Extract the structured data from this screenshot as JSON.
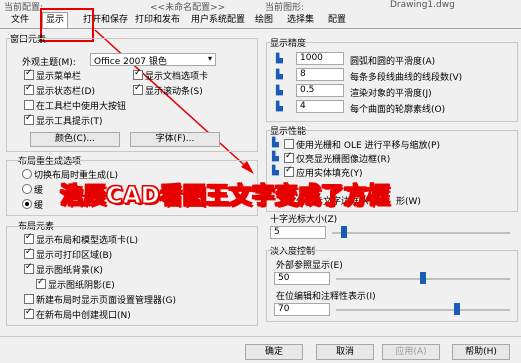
{
  "header": {
    "current_profile_label": "当前配置:",
    "current_profile_value": "<<未命名配置>>",
    "current_drawing_label": "当前图形:",
    "current_drawing_value": "Drawing1.dwg"
  },
  "tabs": [
    {
      "label": "文件"
    },
    {
      "label": "显示"
    },
    {
      "label": "打开和保存"
    },
    {
      "label": "打印和发布"
    },
    {
      "label": "用户系统配置"
    },
    {
      "label": "绘图"
    },
    {
      "label": "选择集"
    },
    {
      "label": "配置"
    }
  ],
  "window_elements": {
    "title": "窗口元素",
    "theme_label": "外观主题(M):",
    "theme_value": "Office 2007 银色",
    "checks": [
      {
        "label": "显示菜单栏",
        "checked": true
      },
      {
        "label": "显示文档选项卡",
        "checked": true
      },
      {
        "label": "显示状态栏(D)",
        "checked": true
      },
      {
        "label": "显示滚动条(S)",
        "checked": true
      },
      {
        "label": "在工具栏中使用大按钮",
        "checked": false
      },
      {
        "label": "显示工具提示(T)",
        "checked": true
      }
    ],
    "color_button": "颜色(C)...",
    "font_button": "字体(F)..."
  },
  "layout_regen": {
    "title": "布局重生成选项",
    "options": [
      {
        "label": "切换布局时重生成(L)"
      },
      {
        "label": "缓"
      },
      {
        "label": "缓"
      }
    ]
  },
  "layout_elements": {
    "title": "布局元素",
    "checks": [
      {
        "label": "显示布局和模型选项卡(L)",
        "checked": true
      },
      {
        "label": "显示可打印区域(B)",
        "checked": true
      },
      {
        "label": "显示图纸背景(K)",
        "checked": true
      },
      {
        "label": "显示图纸阴影(E)",
        "checked": true
      },
      {
        "label": "新建布局时显示页面设置管理器(G)",
        "checked": false
      },
      {
        "label": "在新布局中创建视口(N)",
        "checked": true
      }
    ]
  },
  "display_precision": {
    "title": "显示精度",
    "rows": [
      {
        "value": "1000",
        "label": "圆弧和圆的平滑度(A)"
      },
      {
        "value": "8",
        "label": "每条多段线曲线的线段数(V)"
      },
      {
        "value": "0.5",
        "label": "渲染对象的平滑度(J)"
      },
      {
        "value": "4",
        "label": "每个曲面的轮廓素线(O)"
      }
    ]
  },
  "display_performance": {
    "title": "显示性能",
    "checks": [
      {
        "label": "使用光栅和 OLE 进行平移与缩放(P)",
        "checked": false
      },
      {
        "label": "仅亮显光栅图像边框(R)",
        "checked": true
      },
      {
        "label": "应用实体填充(Y)",
        "checked": true
      },
      {
        "label": "仅显示文字边框(X)",
        "checked": false
      }
    ],
    "extra_button": "形(W)"
  },
  "crosshair": {
    "title": "十字光标大小(Z)",
    "value": "5",
    "level": 0.05
  },
  "fade": {
    "title": "淡入度控制",
    "xref_label": "外部参照显示(E)",
    "xref_value": "50",
    "xref_level": 0.5,
    "inplace_label": "在位编辑和注释性表示(I)",
    "inplace_value": "70",
    "inplace_level": 0.7
  },
  "footer": {
    "ok": "确定",
    "cancel": "取消",
    "apply": "应用(A)",
    "help": "帮助(H)"
  },
  "banner_text": "浩辰CAD看图王文字变成了方框",
  "colors": {
    "annotation_red": "#e60000",
    "accent_blue": "#1a5bb5"
  }
}
